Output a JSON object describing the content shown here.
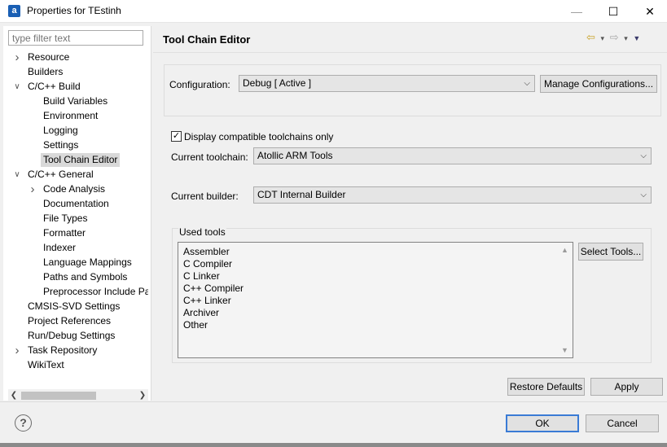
{
  "window": {
    "title": "Properties for TEstinh",
    "app_icon": "a",
    "minimize": "—",
    "maximize": "☐",
    "close": "✕"
  },
  "filter": {
    "placeholder": "type filter text"
  },
  "tree": {
    "items": [
      {
        "label": "Resource",
        "expander": "collapsed"
      },
      {
        "label": "Builders",
        "expander": "none"
      },
      {
        "label": "C/C++ Build",
        "expander": "expanded"
      },
      {
        "label": "Build Variables",
        "expander": "none"
      },
      {
        "label": "Environment",
        "expander": "none"
      },
      {
        "label": "Logging",
        "expander": "none"
      },
      {
        "label": "Settings",
        "expander": "none"
      },
      {
        "label": "Tool Chain Editor",
        "expander": "none",
        "selected": true
      },
      {
        "label": "C/C++ General",
        "expander": "expanded"
      },
      {
        "label": "Code Analysis",
        "expander": "collapsed"
      },
      {
        "label": "Documentation",
        "expander": "none"
      },
      {
        "label": "File Types",
        "expander": "none"
      },
      {
        "label": "Formatter",
        "expander": "none"
      },
      {
        "label": "Indexer",
        "expander": "none"
      },
      {
        "label": "Language Mappings",
        "expander": "none"
      },
      {
        "label": "Paths and Symbols",
        "expander": "none"
      },
      {
        "label": "Preprocessor Include Pa",
        "expander": "none"
      },
      {
        "label": "CMSIS-SVD Settings",
        "expander": "none"
      },
      {
        "label": "Project References",
        "expander": "none"
      },
      {
        "label": "Run/Debug Settings",
        "expander": "none"
      },
      {
        "label": "Task Repository",
        "expander": "collapsed"
      },
      {
        "label": "WikiText",
        "expander": "none"
      }
    ]
  },
  "page": {
    "title": "Tool Chain Editor",
    "nav": {
      "back": "⇦",
      "forward": "⇨",
      "dropdown": "▾",
      "menu": "▼"
    }
  },
  "configuration": {
    "label": "Configuration:",
    "value": "Debug  [ Active ]",
    "manage_button": "Manage Configurations..."
  },
  "compatible": {
    "label": "Display compatible toolchains only",
    "checked": true,
    "check_glyph": "✓"
  },
  "toolchain": {
    "label": "Current toolchain:",
    "value": "Atollic ARM Tools"
  },
  "builder": {
    "label": "Current builder:",
    "value": "CDT Internal Builder"
  },
  "used_tools": {
    "label": "Used tools",
    "items": [
      "Assembler",
      "C Compiler",
      "C Linker",
      "C++ Compiler",
      "C++ Linker",
      "Archiver",
      "Other"
    ],
    "select_button": "Select Tools..."
  },
  "buttons": {
    "restore": "Restore Defaults",
    "apply": "Apply",
    "ok": "OK",
    "cancel": "Cancel",
    "help": "?"
  }
}
